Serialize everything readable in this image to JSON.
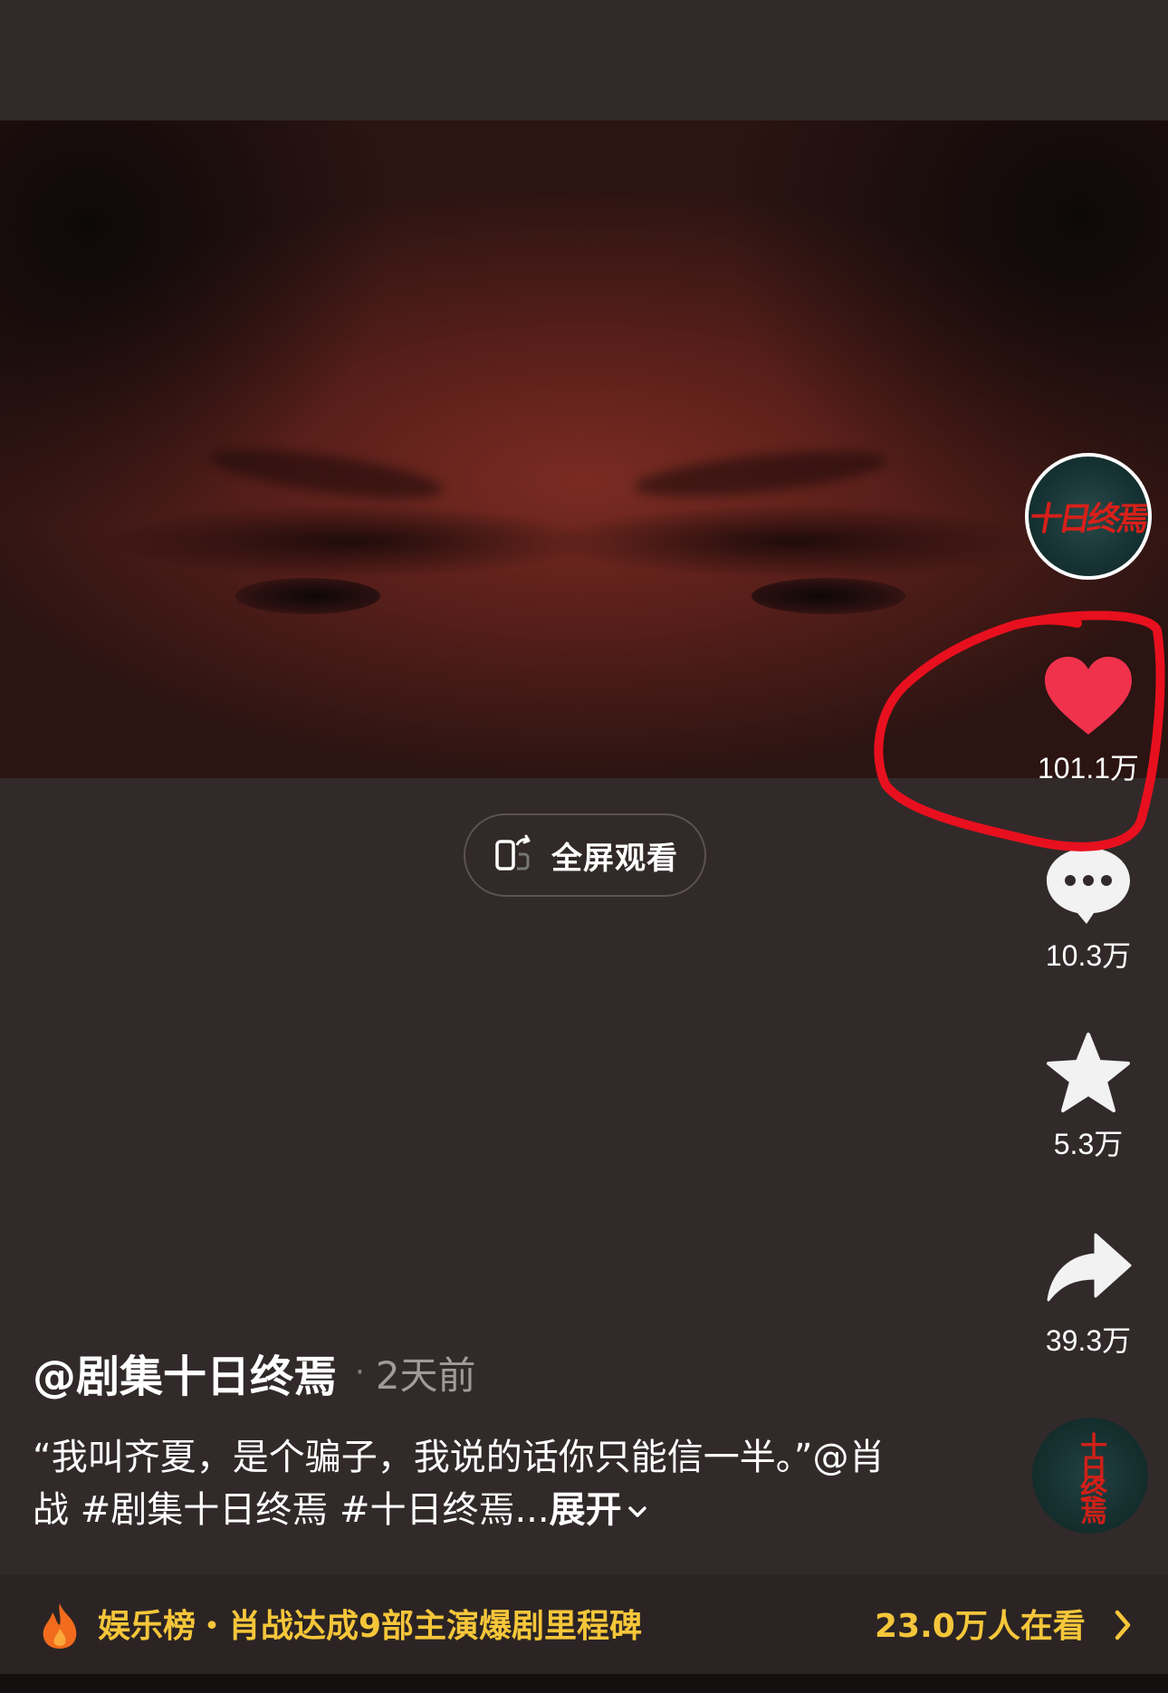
{
  "video": {
    "fullscreen_label": "全屏观看"
  },
  "side_actions": {
    "avatar_logo_text": "十日终焉",
    "like_count": "101.1万",
    "comment_count": "10.3万",
    "favorite_count": "5.3万",
    "share_count": "39.3万",
    "like_color": "#f0324d"
  },
  "post": {
    "author": "@剧集十日终焉",
    "separator": "·",
    "time": "2天前",
    "description": "“我叫齐夏，是个骗子，我说的话你只能信一半。”@肖战 #剧集十日终焉 #十日终焉...",
    "expand_label": "展开"
  },
  "music": {
    "disc_text": "十日终焉"
  },
  "bottom_bar": {
    "rank_text": "娱乐榜・肖战达成9部主演爆剧里程碑",
    "viewers_text": "23.0万人在看",
    "accent_color": "#f5c63a",
    "icon": "flame-icon"
  },
  "annotation": {
    "circle_color": "#e8101e"
  }
}
